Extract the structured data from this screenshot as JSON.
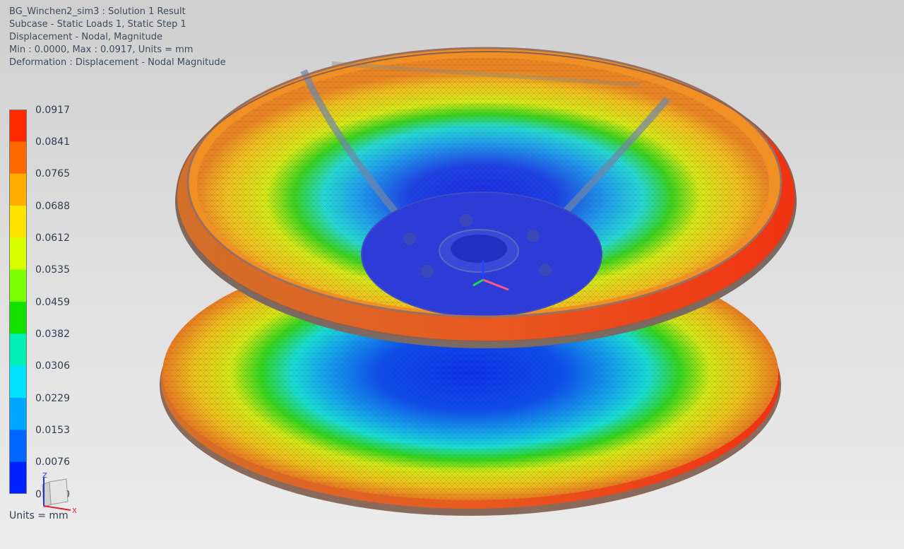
{
  "header": {
    "line1": "BG_Winchen2_sim3 : Solution 1 Result",
    "line2": "Subcase - Static Loads 1, Static Step 1",
    "line3": "Displacement - Nodal, Magnitude",
    "line4": "Min : 0.0000, Max : 0.0917, Units = mm",
    "line5": "Deformation : Displacement - Nodal Magnitude"
  },
  "legend": {
    "ticks": [
      "0.0917",
      "0.0841",
      "0.0765",
      "0.0688",
      "0.0612",
      "0.0535",
      "0.0459",
      "0.0382",
      "0.0306",
      "0.0229",
      "0.0153",
      "0.0076",
      "0.0000"
    ],
    "colors": [
      "#ff2a00",
      "#ff6a00",
      "#ffae00",
      "#ffe400",
      "#d8ff00",
      "#7cff00",
      "#14e000",
      "#00f0b4",
      "#00e2ff",
      "#00a6ff",
      "#0066ff",
      "#0022ff"
    ],
    "units": "Units = mm"
  },
  "triad": {
    "z": "Z",
    "x": "X"
  }
}
